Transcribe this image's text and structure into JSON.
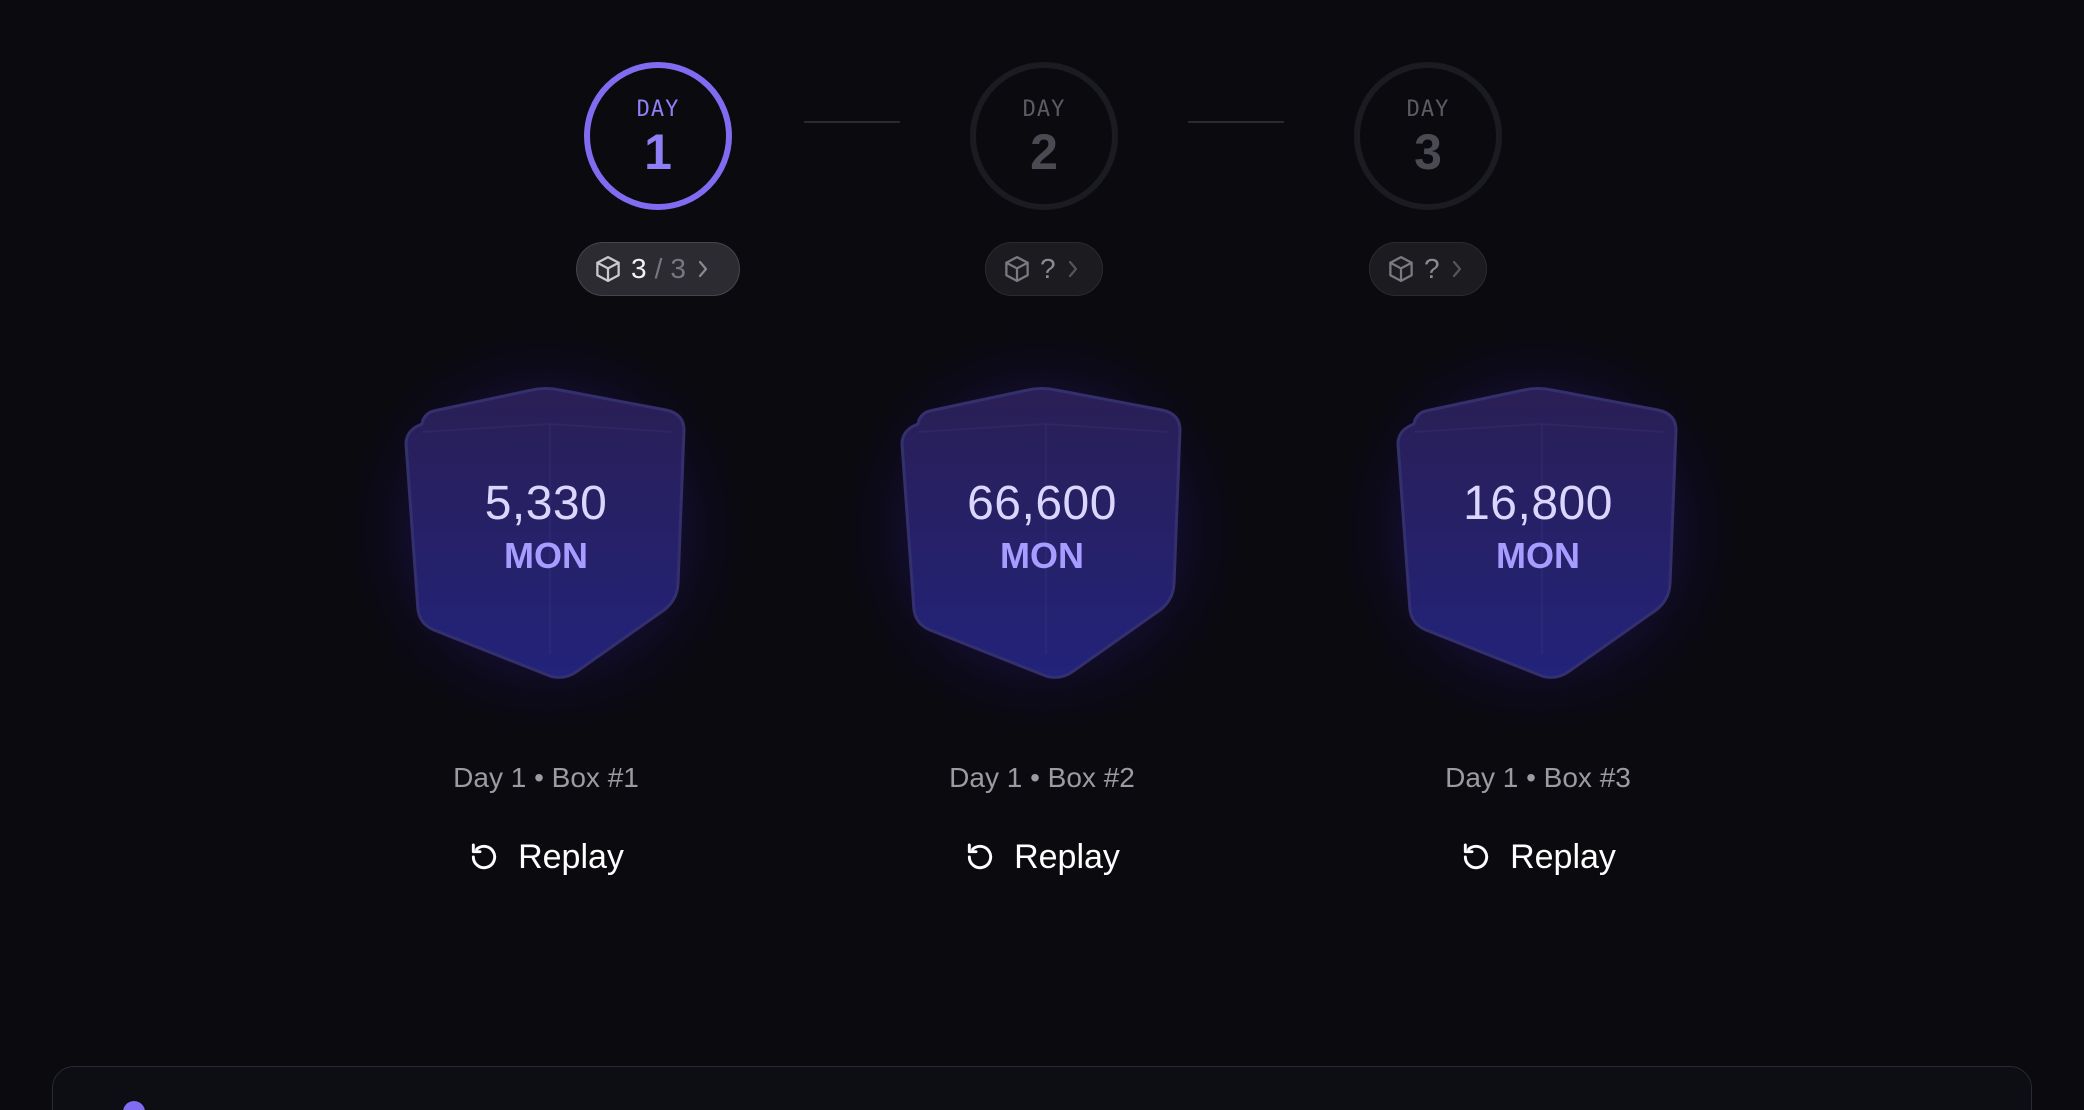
{
  "stepper": {
    "days": [
      {
        "label": "DAY",
        "number": "1",
        "state": "active",
        "box_count": "3",
        "box_sep": "/",
        "box_total": "3"
      },
      {
        "label": "DAY",
        "number": "2",
        "state": "inactive",
        "box_count": "?",
        "box_sep": "",
        "box_total": ""
      },
      {
        "label": "DAY",
        "number": "3",
        "state": "inactive",
        "box_count": "?",
        "box_sep": "",
        "box_total": ""
      }
    ]
  },
  "boxes": [
    {
      "amount": "5,330",
      "unit": "MON",
      "caption": "Day 1 • Box #1",
      "replay_label": "Replay"
    },
    {
      "amount": "66,600",
      "unit": "MON",
      "caption": "Day 1 • Box #2",
      "replay_label": "Replay"
    },
    {
      "amount": "16,800",
      "unit": "MON",
      "caption": "Day 1 • Box #3",
      "replay_label": "Replay"
    }
  ],
  "icons": {
    "pill": "cube-icon",
    "pill_chevron": "chevron-right-icon",
    "replay": "replay-icon"
  },
  "colors": {
    "background": "#0a0a0f",
    "accent": "#7f6cf0",
    "cube_text": "#dcd6ff",
    "cube_unit": "#a79cff"
  }
}
